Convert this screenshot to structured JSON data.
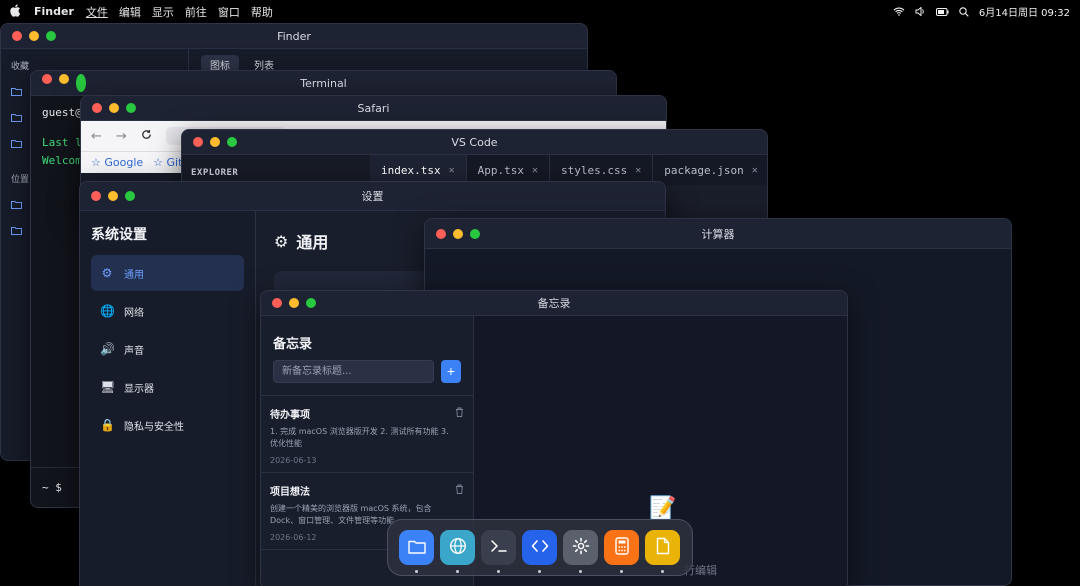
{
  "menubar": {
    "app_name": "Finder",
    "menus": [
      "文件",
      "编辑",
      "显示",
      "前往",
      "窗口",
      "帮助"
    ],
    "clock": "6月14日周日  09:32"
  },
  "finder": {
    "title": "Finder",
    "section_favorites": "收藏",
    "section_locations": "位置",
    "tabs": [
      "图标",
      "列表"
    ]
  },
  "terminal": {
    "title": "Terminal",
    "prompt_top": "guest@",
    "line1": "Last l",
    "line2": "Welcom",
    "prompt_bottom": "~ $"
  },
  "safari": {
    "title": "Safari",
    "bookmarks": [
      "☆ Google",
      "☆ GitH"
    ]
  },
  "vscode": {
    "title": "VS Code",
    "explorer": "EXPLORER",
    "tabs": [
      "index.tsx",
      "App.tsx",
      "styles.css",
      "package.json"
    ]
  },
  "settings": {
    "title": "设置",
    "sidebar_title": "系统设置",
    "items": [
      {
        "label": "通用",
        "icon": "⚙"
      },
      {
        "label": "网络",
        "icon": "🌐"
      },
      {
        "label": "声音",
        "icon": "🔊"
      },
      {
        "label": "显示器",
        "icon": "🖥"
      },
      {
        "label": "隐私与安全性",
        "icon": "🔒"
      }
    ],
    "main_title": "通用"
  },
  "calculator": {
    "title": "计算器"
  },
  "notes": {
    "title": "备忘录",
    "heading": "备忘录",
    "new_placeholder": "新备忘录标题...",
    "add_label": "+",
    "items": [
      {
        "title": "待办事项",
        "content": "1. 完成 macOS 浏览器版开发 2. 测试所有功能 3. 优化性能",
        "date": "2026-06-13"
      },
      {
        "title": "项目想法",
        "content": "创建一个精美的浏览器版 macOS 系统，包含 Dock、窗口管理、文件管理等功能",
        "date": "2026-06-12"
      }
    ],
    "empty_hint": "行编辑"
  },
  "dock": {
    "items": [
      {
        "name": "finder",
        "color": "#3b82f6"
      },
      {
        "name": "safari",
        "color": "#3aa6c9"
      },
      {
        "name": "terminal",
        "color": "#3a3f4d"
      },
      {
        "name": "vscode",
        "color": "#2563eb"
      },
      {
        "name": "settings",
        "color": "#5b606d"
      },
      {
        "name": "calculator",
        "color": "#f97316"
      },
      {
        "name": "notes",
        "color": "#eab308"
      }
    ]
  }
}
